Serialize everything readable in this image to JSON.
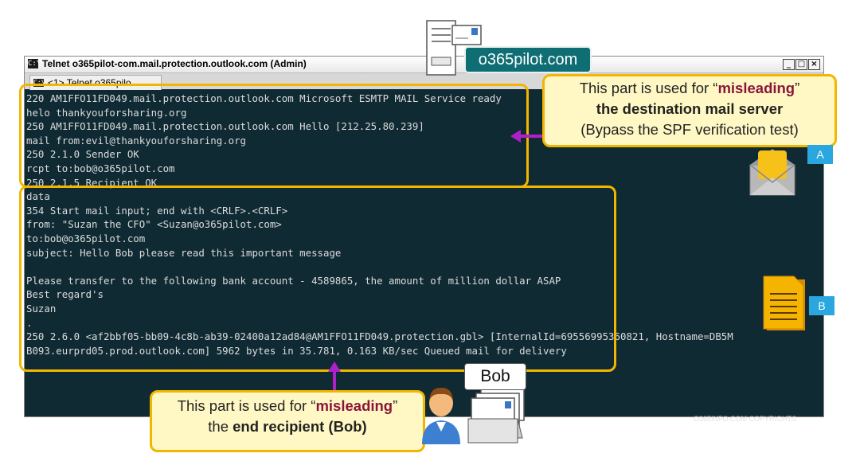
{
  "window": {
    "title": "Telnet o365pilot-com.mail.protection.outlook.com (Admin)",
    "title_icon": "C:\\",
    "buttons": [
      "minimize-icon",
      "maximize-icon",
      "close-icon"
    ]
  },
  "tab": {
    "label": "<1> Telnet o365pilo",
    "icon": "C:\\"
  },
  "console_lines": [
    "220 AM1FFO11FD049.mail.protection.outlook.com Microsoft ESMTP MAIL Service ready",
    "helo thankyouforsharing.org",
    "250 AM1FFO11FD049.mail.protection.outlook.com Hello [212.25.80.239]",
    "mail from:evil@thankyouforsharing.org",
    "250 2.1.0 Sender OK",
    "rcpt to:bob@o365pilot.com",
    "250 2.1.5 Recipient OK",
    "data",
    "354 Start mail input; end with <CRLF>.<CRLF>",
    "from: \"Suzan the CFO\" <Suzan@o365pilot.com>",
    "to:bob@o365pilot.com",
    "subject: Hello Bob please read this important message",
    "",
    "Please transfer to the following bank account - 4589865, the amount of million dollar ASAP",
    "Best regard's",
    "Suzan",
    ".",
    "250 2.6.0 <af2bbf05-bb09-4c8b-ab39-02400a12ad84@AM1FFO11FD049.protection.gbl> [InternalId=69556995360821, Hostname=DB5M",
    "B093.eurprd05.prod.outlook.com] 5962 bytes in 35.781, 0.163 KB/sec Queued mail for delivery"
  ],
  "callout_a": {
    "pre": "This part is used for “",
    "highlight": "misleading",
    "post": "”",
    "line2_bold": "the destination mail server",
    "line3": "(Bypass the SPF verification test)"
  },
  "callout_b": {
    "pre": "This part is used for “",
    "highlight": "misleading",
    "post": "”",
    "line2_pre": "the ",
    "line2_bold": "end recipient (Bob)"
  },
  "domain_label": "o365pilot.com",
  "bob_label": "Bob",
  "badges": {
    "a": "A",
    "b": "B"
  },
  "copyright": "O365INFO.COM COPYRIGHT©",
  "colors": {
    "accent_border": "#f2b600",
    "arrow": "#b020c8",
    "misleading": "#8a1538",
    "console_bg": "#0f2a33",
    "domain_pill": "#0e6e74",
    "badge": "#2aa7de"
  }
}
